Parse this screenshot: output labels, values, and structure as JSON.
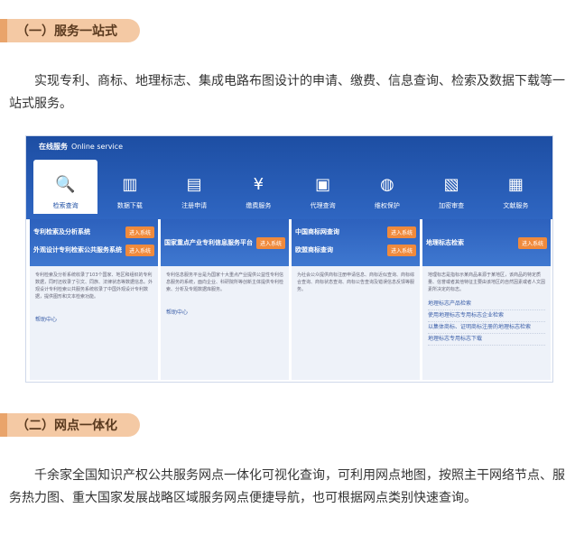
{
  "section1": {
    "title": "（一）服务一站式",
    "text": "实现专利、商标、地理标志、集成电路布图设计的申请、缴费、信息查询、检索及数据下载等一站式服务。"
  },
  "panel": {
    "title": "在线服务",
    "title_en": "Online service",
    "tabs": [
      {
        "label": "检索查询",
        "icon": "search-doc-icon"
      },
      {
        "label": "数据下载",
        "icon": "chart-icon"
      },
      {
        "label": "注册申请",
        "icon": "form-icon"
      },
      {
        "label": "缴费服务",
        "icon": "hand-money-icon"
      },
      {
        "label": "代理查询",
        "icon": "briefcase-icon"
      },
      {
        "label": "维权保护",
        "icon": "globe-icon"
      },
      {
        "label": "加密审查",
        "icon": "monitor-icon"
      },
      {
        "label": "文献服务",
        "icon": "document-icon"
      }
    ],
    "enter_label": "进入系统",
    "cols": [
      {
        "titles": [
          "专利检索及分析系统",
          "外观设计专利检索公共服务系统"
        ],
        "body": "专利检索及分析系统收录了103个国家、地区和组织的专利数据，同时还收录了引文、同族、法律状态等数据信息。外观设计专利检索公共服务系统收录了中国外观设计专利数据，提供图形和文本检索功能。",
        "link": "帮助中心"
      },
      {
        "titles": [
          "国家重点产业专利信息服务平台"
        ],
        "body": "专利信息服务平台是为国家十大重点产业提供公益性专利信息服务的系统，面向企业、科研院所等创新主体提供专利检索、分析及专题数据库服务。",
        "link": "帮助中心"
      },
      {
        "titles": [
          "中国商标网查询",
          "欧盟商标查询"
        ],
        "body": "为社会公众提供商标注册申请信息、商标近似查询、商标综合查询、商标状态查询、商标公告查询及错误信息反馈等服务。",
        "link": ""
      },
      {
        "titles": [
          "地理标志检索"
        ],
        "body": "地理标志是指标示某商品来源于某地区，该商品的特定质量、信誉或者其他特征主要由该地区的自然因素或者人文因素所决定的标志。",
        "list": [
          "地理标志产品检索",
          "使用地理标志专用标志企业检索",
          "以集体商标、证明商标注册的地理标志检索",
          "地理标志专用标志下载"
        ]
      }
    ]
  },
  "section2": {
    "title": "（二）网点一体化",
    "text": "千余家全国知识产权公共服务网点一体化可视化查询，可利用网点地图，按照主干网络节点、服务热力图、重大国家发展战略区域服务网点便捷导航，也可根据网点类别快速查询。"
  }
}
